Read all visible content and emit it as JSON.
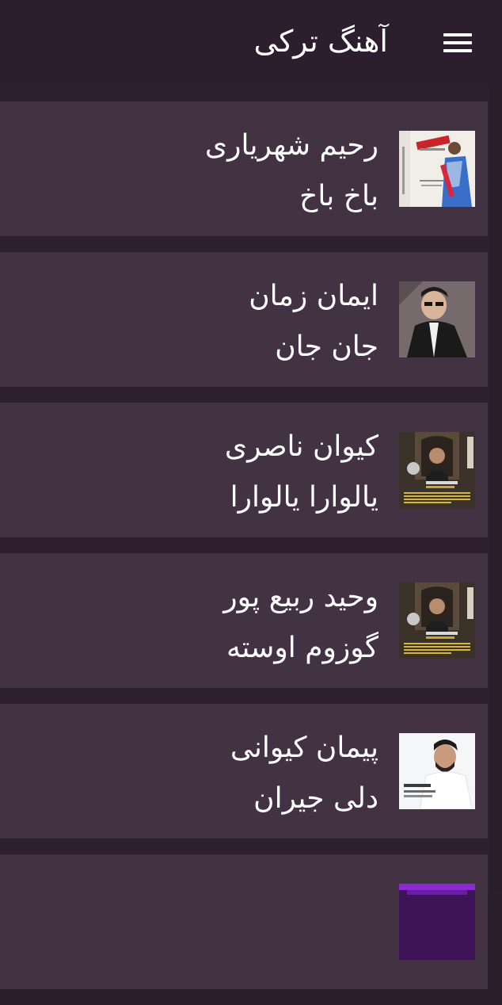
{
  "header": {
    "title": "آهنگ ترکی",
    "menu_icon": "hamburger-menu-icon"
  },
  "songs": [
    {
      "artist": "رحیم شهریاری",
      "title": "باخ باخ",
      "cover_icon": "album-cover"
    },
    {
      "artist": "ایمان زمان",
      "title": "جان جان",
      "cover_icon": "album-cover"
    },
    {
      "artist": "کیوان ناصری",
      "title": "یالوارا یالوارا",
      "cover_icon": "album-cover"
    },
    {
      "artist": "وحید ربیع پور",
      "title": "گوزوم اوسته",
      "cover_icon": "album-cover"
    },
    {
      "artist": "پیمان کیوانی",
      "title": "دلی جیران",
      "cover_icon": "album-cover"
    }
  ],
  "colors": {
    "background": "#2d1f2d",
    "card": "#433342",
    "text": "#ffffff"
  }
}
